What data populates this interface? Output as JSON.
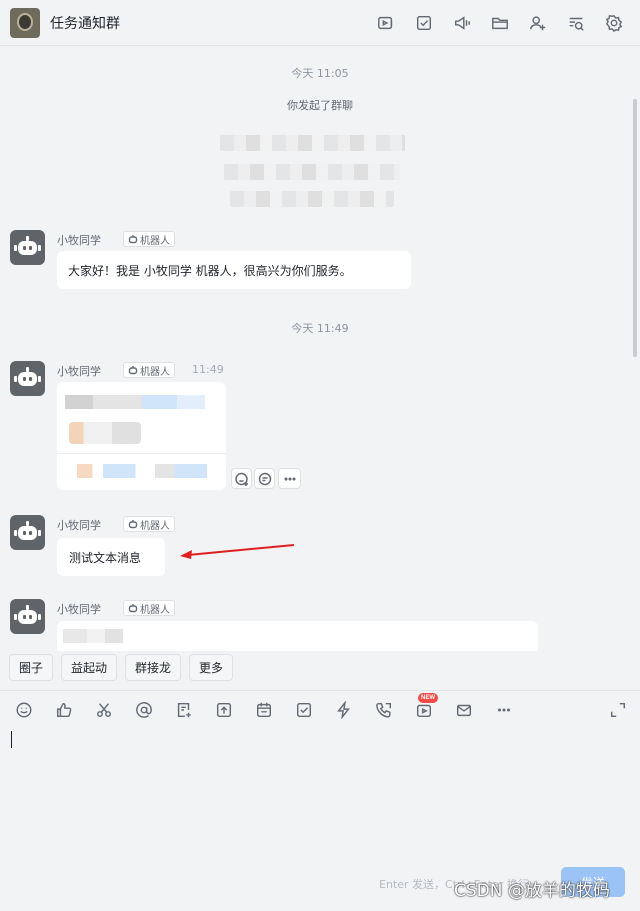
{
  "header": {
    "title": "任务通知群",
    "icons": [
      "video-meeting-icon",
      "todo-icon",
      "announcement-icon",
      "folder-icon",
      "add-member-icon",
      "search-history-icon",
      "settings-icon"
    ]
  },
  "chat": {
    "time_1": "今天 11:05",
    "system_msg": "你发起了群聊",
    "time_2": "今天 11:49",
    "messages": [
      {
        "sender": "小牧同学",
        "tag": "机器人",
        "time": "",
        "text": "大家好！我是 小牧同学 机器人，很高兴为你们服务。"
      },
      {
        "sender": "小牧同学",
        "tag": "机器人",
        "time": "11:49",
        "text": ""
      },
      {
        "sender": "小牧同学",
        "tag": "机器人",
        "time": "",
        "text": "测试文本消息"
      },
      {
        "sender": "小牧同学",
        "tag": "机器人",
        "time": "",
        "text": ""
      }
    ]
  },
  "chips": [
    "圈子",
    "益起动",
    "群接龙",
    "更多"
  ],
  "toolbar": {
    "icons": [
      "emoji-icon",
      "thumbs-up-icon",
      "screenshot-icon",
      "mention-icon",
      "doc-add-icon",
      "upload-icon",
      "calendar-icon",
      "task-icon",
      "quick-action-icon",
      "call-icon",
      "live-icon",
      "mail-icon",
      "more-icon"
    ],
    "new_badge": "NEW"
  },
  "input": {
    "hint": "Enter 发送，Ctrl+Enter 换行",
    "send_label": "发送"
  },
  "watermark": "CSDN @放羊的牧码"
}
